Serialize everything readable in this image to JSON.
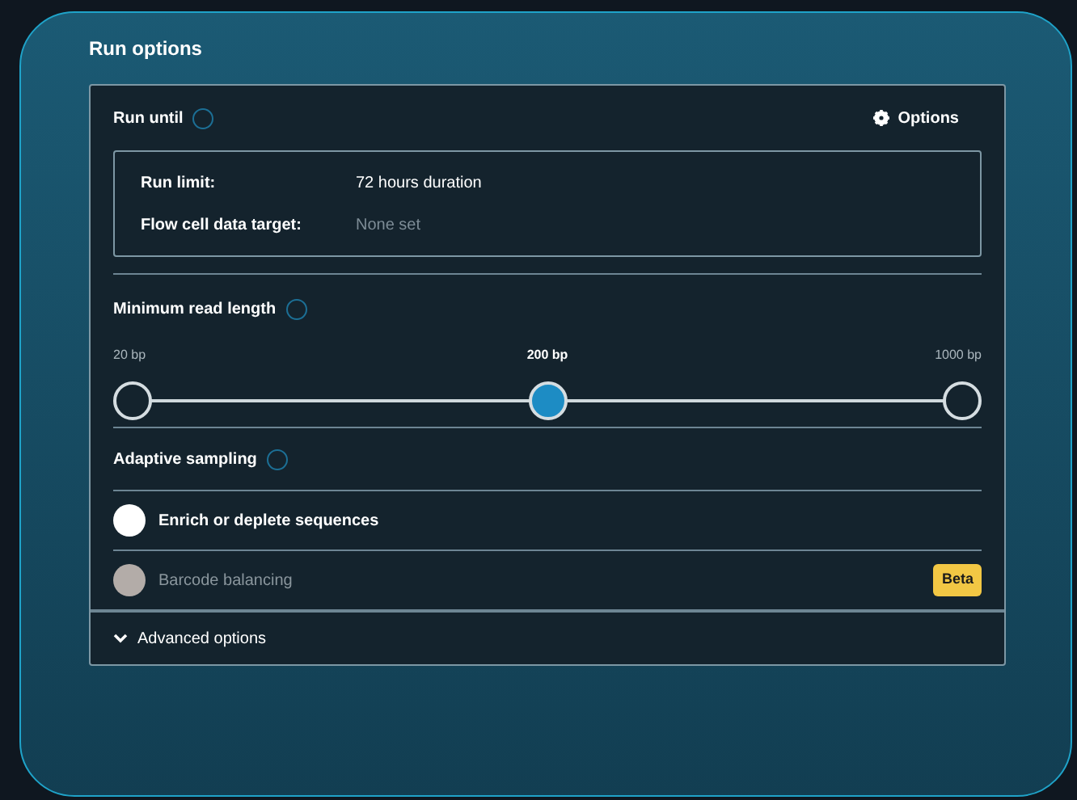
{
  "title": "Run options",
  "run_until": {
    "label": "Run until",
    "options_button": "Options",
    "rows": [
      {
        "label": "Run limit:",
        "value": "72 hours duration",
        "set": true
      },
      {
        "label": "Flow cell data target:",
        "value": "None set",
        "set": false
      }
    ]
  },
  "min_read_length": {
    "label": "Minimum read length",
    "stops": [
      {
        "label": "20 bp",
        "selected": false
      },
      {
        "label": "200 bp",
        "selected": true
      },
      {
        "label": "1000 bp",
        "selected": false
      }
    ]
  },
  "adaptive_sampling": {
    "label": "Adaptive sampling",
    "options": [
      {
        "label": "Enrich or deplete sequences",
        "disabled": false
      },
      {
        "label": "Barcode balancing",
        "disabled": true,
        "badge": "Beta"
      }
    ]
  },
  "advanced": {
    "label": "Advanced options",
    "expanded": false
  }
}
